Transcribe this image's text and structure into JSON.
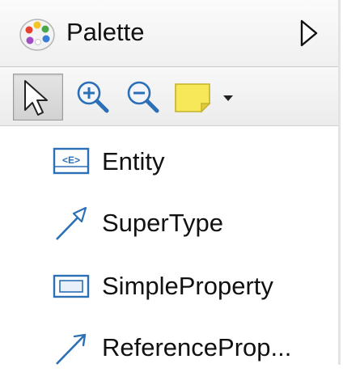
{
  "header": {
    "title": "Palette",
    "icon": "palette-icon",
    "collapse_icon": "triangle-right-icon"
  },
  "toolbar": {
    "tools": [
      {
        "name": "select",
        "icon": "arrow-cursor-icon",
        "selected": true
      },
      {
        "name": "zoom-in",
        "icon": "zoom-in-icon"
      },
      {
        "name": "zoom-out",
        "icon": "zoom-out-icon"
      },
      {
        "name": "note",
        "icon": "note-icon"
      },
      {
        "name": "note-dropdown",
        "icon": "dropdown-arrow-icon"
      }
    ]
  },
  "items": [
    {
      "label": "Entity",
      "icon": "entity-icon"
    },
    {
      "label": "SuperType",
      "icon": "supertype-arrow-icon"
    },
    {
      "label": "SimpleProperty",
      "icon": "simple-property-icon"
    },
    {
      "label": "ReferenceProp...",
      "icon": "reference-arrow-icon"
    }
  ],
  "colors": {
    "icon_blue": "#2b6fb6",
    "note_yellow": "#f7e85a",
    "header_bg": "#f4f4f4"
  }
}
